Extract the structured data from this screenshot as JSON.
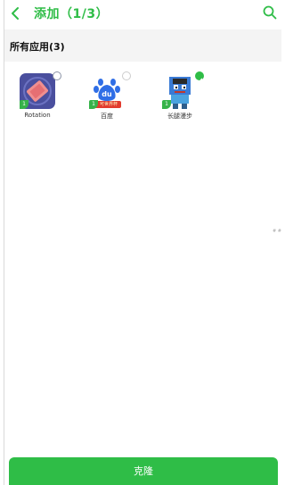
{
  "header": {
    "title": "添加（1/3）",
    "back_icon": "chevron-left-icon",
    "search_icon": "search-icon"
  },
  "section": {
    "title": "所有应用(3)"
  },
  "apps": [
    {
      "label": "Rotation",
      "badge": "1",
      "selected": false
    },
    {
      "label": "百度",
      "badge": "1",
      "selected": false,
      "sublabel": "可世界杯"
    },
    {
      "label": "长腿漫步",
      "badge": "1",
      "selected": true
    }
  ],
  "edge_marks": "# #",
  "footer": {
    "clone_label": "克隆"
  },
  "colors": {
    "accent": "#2fbd47",
    "section_bg": "#f4f4f4"
  }
}
